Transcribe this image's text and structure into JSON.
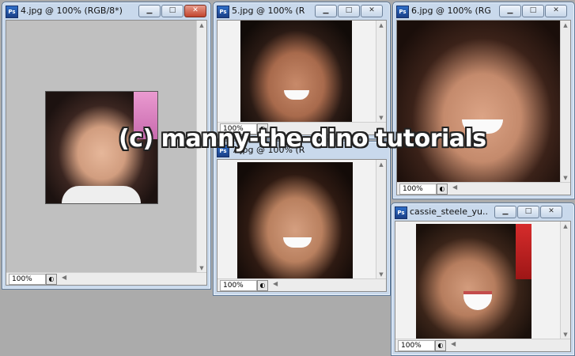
{
  "windows": [
    {
      "id": "w4",
      "title": "4.jpg @ 100% (RGB/8*)",
      "zoom": "100%",
      "has_close_red": true
    },
    {
      "id": "w5",
      "title": "5.jpg @ 100% (R",
      "zoom": "100%",
      "has_close_red": false
    },
    {
      "id": "w6",
      "title": "6.jpg @ 100% (RG",
      "zoom": "100%",
      "has_close_red": false
    },
    {
      "id": "w7",
      "title": "7.jpg @ 100% (R",
      "zoom": "100%",
      "has_close_red": false
    },
    {
      "id": "wc",
      "title": "cassie_steele_yu...",
      "zoom": "100%",
      "has_close_red": false
    }
  ],
  "icons": {
    "app": "photoshop-icon",
    "minimize": "minimize-icon",
    "maximize": "maximize-icon",
    "close": "close-icon",
    "navigator": "navigator-icon",
    "scroll_up": "arrow-up-icon",
    "scroll_down": "arrow-down-icon",
    "scroll_left": "arrow-left-icon"
  },
  "labels": {
    "ps": "Ps",
    "min": "▁",
    "max": "□",
    "close": "✕",
    "up": "▲",
    "down": "▼",
    "left": "◀"
  },
  "watermark": "(c) manny-the-dino tutorials",
  "colors": {
    "desktop": "#ababab",
    "frame": "#c9d9ec",
    "canvas": "#c0c0c0",
    "close_red": "#c2452e"
  }
}
